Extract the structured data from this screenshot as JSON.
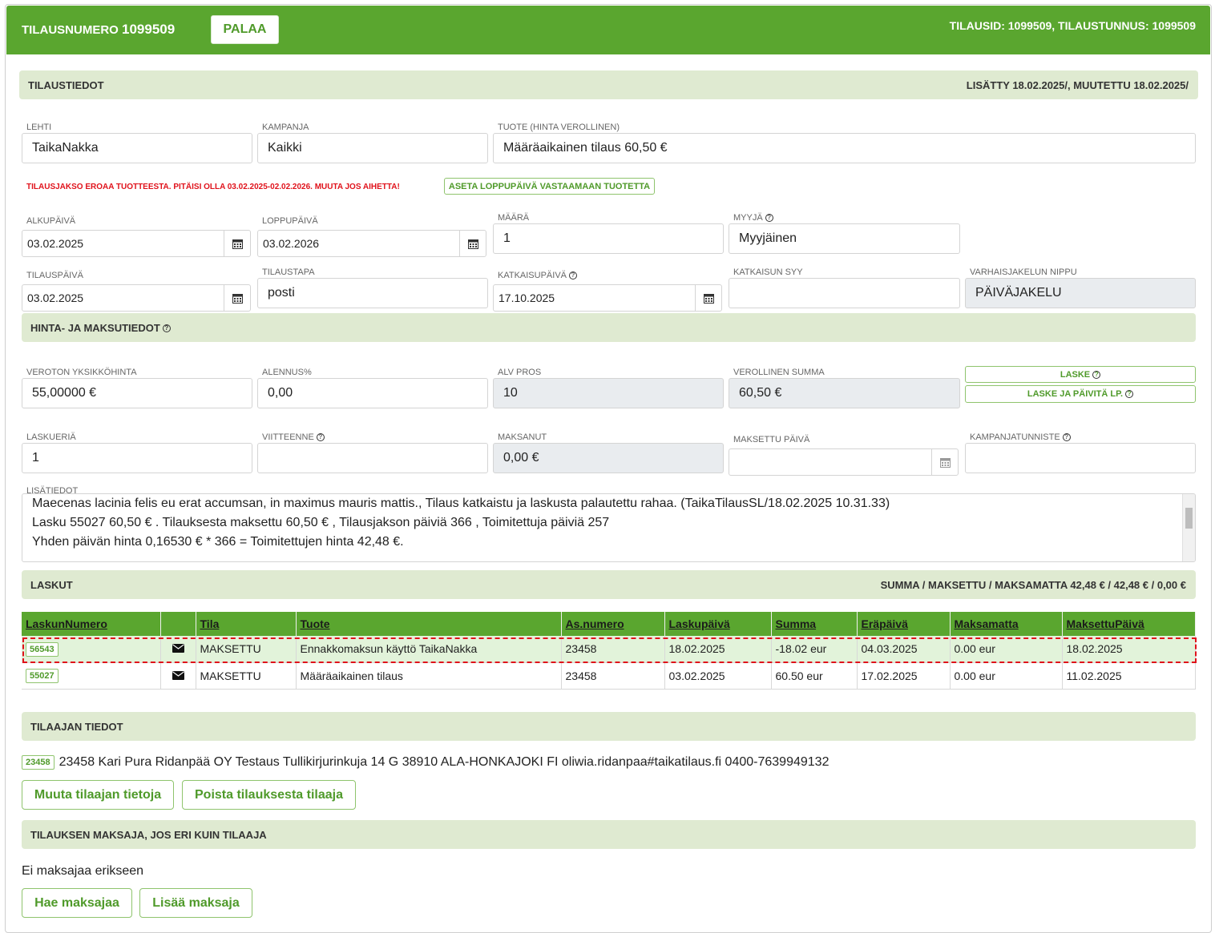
{
  "header": {
    "order_label": "TILAUSNUMERO",
    "order_number": "1099509",
    "back_button": "PALAA",
    "ids": "TILAUSID: 1099509, TILAUSTUNNUS: 1099509"
  },
  "order_info": {
    "title": "TILAUSTIEDOT",
    "meta": "LISÄTTY 18.02.2025/, MUUTETTU 18.02.2025/"
  },
  "fields": {
    "lehti": {
      "label": "LEHTI",
      "value": "TaikaNakka"
    },
    "kampanja": {
      "label": "KAMPANJA",
      "value": "Kaikki"
    },
    "tuote": {
      "label": "TUOTE (HINTA VEROLLINEN)",
      "value": "Määräaikainen tilaus 60,50 €"
    },
    "alkupaiva": {
      "label": "ALKUPÄIVÄ",
      "value": "03.02.2025"
    },
    "loppupaiva": {
      "label": "LOPPUPÄIVÄ",
      "value": "03.02.2026"
    },
    "maara": {
      "label": "MÄÄRÄ",
      "value": "1"
    },
    "myyja": {
      "label": "MYYJÄ",
      "value": "Myyjäinen"
    },
    "tilauspaiva": {
      "label": "TILAUSPÄIVÄ",
      "value": "03.02.2025"
    },
    "tilaustapa": {
      "label": "TILAUSTAPA",
      "value": "posti"
    },
    "katkaisupaiva": {
      "label": "KATKAISUPÄIVÄ",
      "value": "17.10.2025"
    },
    "katkaisun_syy": {
      "label": "KATKAISUN SYY",
      "value": ""
    },
    "varhaisjakelun_nippu": {
      "label": "VARHAISJAKELUN NIPPU",
      "value": "PÄIVÄJAKELU"
    }
  },
  "warning": {
    "text": "TILAUSJAKSO EROAA TUOTTEESTA. PITÄISI OLLA 03.02.2025-02.02.2026. MUUTA JOS AIHETTA!",
    "button": "ASETA LOPPUPÄIVÄ VASTAAMAAN TUOTETTA"
  },
  "pricing": {
    "title": "HINTA- JA MAKSUTIEDOT",
    "veroton": {
      "label": "VEROTON YKSIKKÖHINTA",
      "value": "55,00000 €"
    },
    "alennus": {
      "label": "ALENNUS%",
      "value": "0,00"
    },
    "alv": {
      "label": "ALV PROS",
      "value": "10"
    },
    "verollinen": {
      "label": "VEROLLINEN SUMMA",
      "value": "60,50 €"
    },
    "laske": "LASKE",
    "laske_paivita": "LASKE JA PÄIVITÄ LP.",
    "laskueria": {
      "label": "LASKUERIÄ",
      "value": "1"
    },
    "viitteenne": {
      "label": "VIITTEENNE",
      "value": ""
    },
    "maksanut": {
      "label": "MAKSANUT",
      "value": "0,00 €"
    },
    "maksettu_paiva": {
      "label": "MAKSETTU PÄIVÄ",
      "value": ""
    },
    "kampanjatunniste": {
      "label": "KAMPANJATUNNISTE",
      "value": ""
    }
  },
  "lisatiedot": {
    "label": "LISÄTIEDOT",
    "lines": [
      "Maecenas lacinia felis eu erat accumsan, in maximus mauris mattis., Tilaus katkaistu ja laskusta palautettu rahaa. (TaikaTilausSL/18.02.2025 10.31.33)",
      "Lasku 55027 60,50 € . Tilauksesta maksettu 60,50 € , Tilausjakson päiviä 366 , Toimitettuja päiviä 257",
      "Yhden päivän hinta 0,16530 € * 366 = Toimitettujen hinta 42,48 €."
    ]
  },
  "invoices": {
    "title": "LASKUT",
    "summary": "SUMMA / MAKSETTU / MAKSAMATTA 42,48 € / 42,48 € / 0,00 €",
    "columns": [
      "LaskunNumero",
      "",
      "Tila",
      "Tuote",
      "As.numero",
      "Laskupäivä",
      "Summa",
      "Eräpäivä",
      "Maksamatta",
      "MaksettuPäivä"
    ],
    "rows": [
      {
        "numero": "56543",
        "tila": "MAKSETTU",
        "tuote": "Ennakkomaksun käyttö TaikaNakka",
        "asnumero": "23458",
        "laskupaiva": "18.02.2025",
        "summa": "-18.02 eur",
        "erapaiva": "04.03.2025",
        "maksamatta": "0.00 eur",
        "maksettu": "18.02.2025"
      },
      {
        "numero": "55027",
        "tila": "MAKSETTU",
        "tuote": "Määräaikainen tilaus",
        "asnumero": "23458",
        "laskupaiva": "03.02.2025",
        "summa": "60.50 eur",
        "erapaiva": "17.02.2025",
        "maksamatta": "0.00 eur",
        "maksettu": "11.02.2025"
      }
    ]
  },
  "customer": {
    "title": "TILAAJAN TIEDOT",
    "badge": "23458",
    "info": "23458 Kari Pura Ridanpää OY Testaus Tullikirjurinkuja 14 G 38910 ALA-HONKAJOKI FI oliwia.ridanpaa#taikatilaus.fi 0400-7639949132",
    "edit_button": "Muuta tilaajan tietoja",
    "remove_button": "Poista tilauksesta tilaaja"
  },
  "payer": {
    "title": "TILAUKSEN MAKSAJA, JOS ERI KUIN TILAAJA",
    "none_text": "Ei maksajaa erikseen",
    "search_button": "Hae maksajaa",
    "add_button": "Lisää maksaja"
  },
  "colors": {
    "brand_green": "#5aa62f",
    "section_bg": "#dfead1",
    "warning_red": "#e0121b"
  }
}
